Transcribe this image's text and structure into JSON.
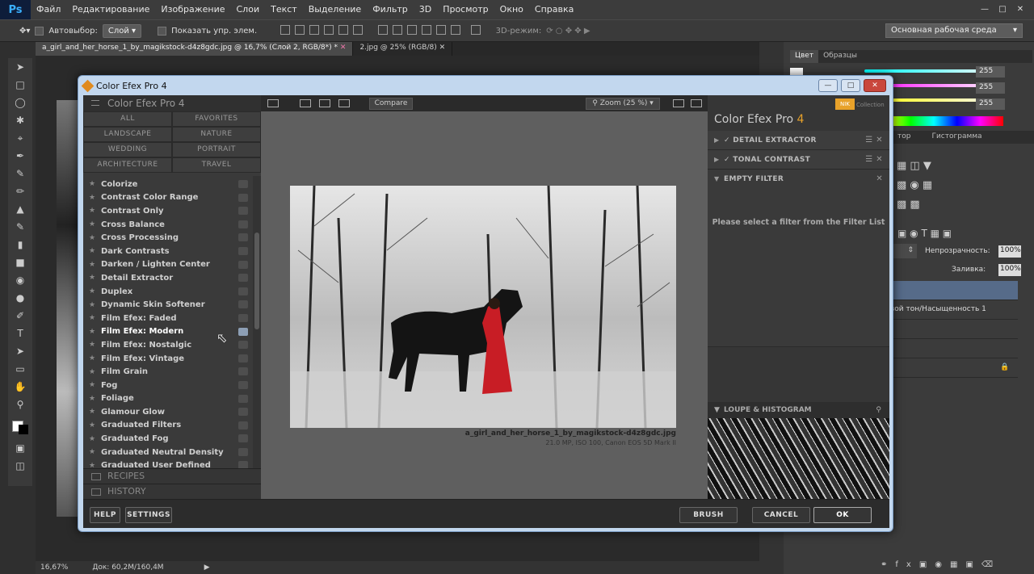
{
  "ps": {
    "logo": "Ps",
    "menu": [
      "Файл",
      "Редактирование",
      "Изображение",
      "Слои",
      "Текст",
      "Выделение",
      "Фильтр",
      "3D",
      "Просмотр",
      "Окно",
      "Справка"
    ],
    "options": {
      "autoselect": "Автовыбор:",
      "layer": "Слой",
      "show_transform": "Показать упр. элем.",
      "mode3d": "3D-режим:"
    },
    "workspace": "Основная рабочая среда",
    "tabs": [
      {
        "label": "a_girl_and_her_horse_1_by_magikstock-d4z8gdc.jpg @ 16,7% (Слой 2, RGB/8*) *"
      },
      {
        "label": "2.jpg @ 25% (RGB/8)"
      }
    ],
    "status": {
      "zoom": "16,67%",
      "doc": "Док: 60,2M/160,4M"
    },
    "panels": {
      "tab_color": "Цвет",
      "tab_swatches": "Образцы",
      "rgb": [
        "255",
        "255",
        "255"
      ],
      "tab_nav": "тор",
      "tab_hist": "Гистограмма",
      "opacity_label": "Непрозрачность:",
      "opacity": "100%",
      "fill_label": "Заливка:",
      "fill": "100%",
      "layer_hue": "вой тон/Насыщенность 1"
    }
  },
  "dialog": {
    "title": "Color Efex Pro 4",
    "header": "Color Efex Pro 4",
    "categories": [
      "ALL",
      "FAVORITES",
      "LANDSCAPE",
      "NATURE",
      "WEDDING",
      "PORTRAIT",
      "ARCHITECTURE",
      "TRAVEL"
    ],
    "filters": [
      "Colorize",
      "Contrast Color Range",
      "Contrast Only",
      "Cross Balance",
      "Cross Processing",
      "Dark Contrasts",
      "Darken / Lighten Center",
      "Detail Extractor",
      "Duplex",
      "Dynamic Skin Softener",
      "Film Efex: Faded",
      "Film Efex: Modern",
      "Film Efex: Nostalgic",
      "Film Efex: Vintage",
      "Film Grain",
      "Fog",
      "Foliage",
      "Glamour Glow",
      "Graduated Filters",
      "Graduated Fog",
      "Graduated Neutral Density",
      "Graduated User Defined"
    ],
    "recipes": "RECIPES",
    "history": "HISTORY",
    "compare": "Compare",
    "zoom": "Zoom (25 %)",
    "filename": "a_girl_and_her_horse_1_by_magikstock-d4z8gdc.jpg",
    "meta": "21.0 MP, ISO 100, Canon EOS 5D Mark II",
    "nik": "NIK",
    "collection": "Collection",
    "title_main": "Color Efex Pro ",
    "title_ver": "4",
    "stack": [
      "DETAIL EXTRACTOR",
      "TONAL CONTRAST",
      "EMPTY FILTER"
    ],
    "empty_msg": "Please select a filter from the Filter List",
    "loupe": "LOUPE & HISTOGRAM",
    "buttons": {
      "help": "HELP",
      "settings": "SETTINGS",
      "brush": "BRUSH",
      "cancel": "CANCEL",
      "ok": "OK"
    }
  }
}
